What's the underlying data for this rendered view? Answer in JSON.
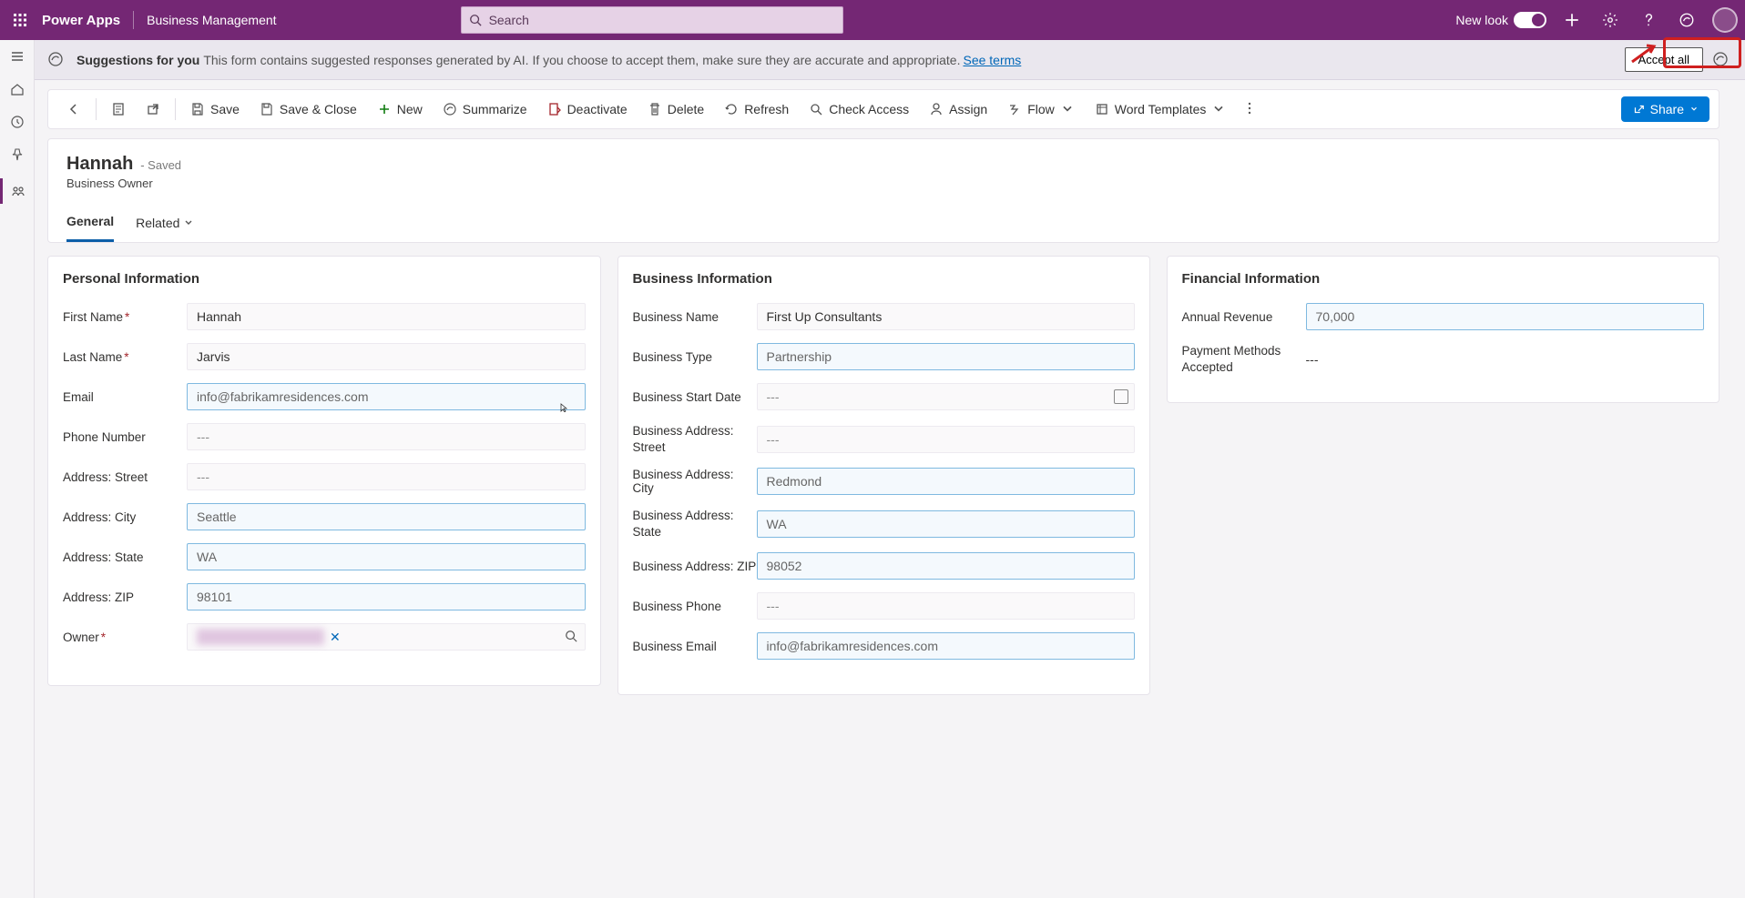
{
  "topbar": {
    "app_name": "Power Apps",
    "app_sub": "Business Management",
    "search_placeholder": "Search",
    "new_look_label": "New look"
  },
  "suggest": {
    "heading": "Suggestions for you",
    "body": "This form contains suggested responses generated by AI. If you choose to accept them, make sure they are accurate and appropriate.",
    "link": "See terms",
    "accept_all": "Accept all"
  },
  "commands": {
    "save": "Save",
    "save_close": "Save & Close",
    "new": "New",
    "summarize": "Summarize",
    "deactivate": "Deactivate",
    "delete": "Delete",
    "refresh": "Refresh",
    "check_access": "Check Access",
    "assign": "Assign",
    "flow": "Flow",
    "word_templates": "Word Templates",
    "share": "Share"
  },
  "record": {
    "title": "Hannah",
    "status": "- Saved",
    "subtitle": "Business Owner"
  },
  "tabs": {
    "general": "General",
    "related": "Related"
  },
  "personal": {
    "heading": "Personal Information",
    "first_name_label": "First Name",
    "first_name": "Hannah",
    "last_name_label": "Last Name",
    "last_name": "Jarvis",
    "email_label": "Email",
    "email": "info@fabrikamresidences.com",
    "phone_label": "Phone Number",
    "phone": "---",
    "street_label": "Address: Street",
    "street": "---",
    "city_label": "Address: City",
    "city": "Seattle",
    "state_label": "Address: State",
    "state": "WA",
    "zip_label": "Address: ZIP",
    "zip": "98101",
    "owner_label": "Owner"
  },
  "business": {
    "heading": "Business Information",
    "name_label": "Business Name",
    "name": "First Up Consultants",
    "type_label": "Business Type",
    "type": "Partnership",
    "start_label": "Business Start Date",
    "start": "---",
    "street_label": "Business Address: Street",
    "street": "---",
    "city_label": "Business Address: City",
    "city": "Redmond",
    "state_label": "Business Address: State",
    "state": "WA",
    "zip_label": "Business Address: ZIP",
    "zip": "98052",
    "phone_label": "Business Phone",
    "phone": "---",
    "email_label": "Business Email",
    "email": "info@fabrikamresidences.com"
  },
  "financial": {
    "heading": "Financial Information",
    "revenue_label": "Annual Revenue",
    "revenue": "70,000",
    "payment_label": "Payment Methods Accepted",
    "payment": "---"
  }
}
